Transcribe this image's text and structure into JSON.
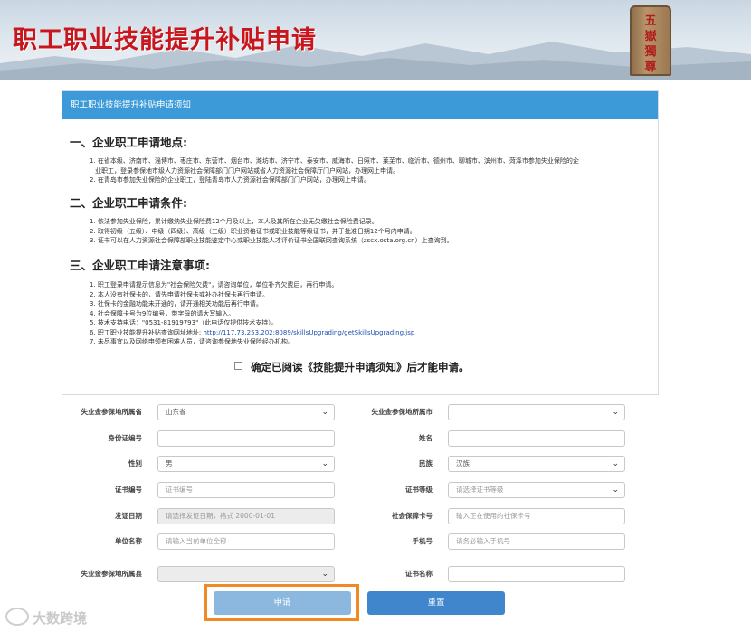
{
  "header": {
    "title": "职工职业技能提升补贴申请",
    "seal_text": [
      "五",
      "嶽",
      "獨",
      "尊"
    ]
  },
  "notice": {
    "heading": "职工职业技能提升补贴申请须知",
    "sections": [
      {
        "title": "一、企业职工申请地点:",
        "items": [
          "1. 在省本级、济南市、淄博市、枣庄市、东营市、烟台市、潍坊市、济宁市、泰安市、威海市、日照市、莱芜市、临沂市、德州市、聊城市、滨州市、菏泽市参加失业保险的企",
          "业职工，登录参保地市级人力资源社会保障部门门户网站或省人力资源社会保障厅门户网站，办理网上申请。",
          "2. 在青岛市参加失业保险的企业职工，登陆青岛市人力资源社会保障部门门户网站，办理网上申请。"
        ]
      },
      {
        "title": "二、企业职工申请条件:",
        "items": [
          "1. 依法参加失业保险，累计缴纳失业保险费12个月及以上，本人及其所在企业无欠缴社会保险费记录。",
          "2. 取得初级（五级）、中级（四级）、高级（三级）职业资格证书或职业技能等级证书，并于批准日期12个月内申请。",
          "3. 证书可以在人力资源社会保障部职业技能鉴定中心或职业技能人才评价证书全国联网查询系统（zscx.osta.org.cn）上查询到。"
        ]
      },
      {
        "title": "三、企业职工申请注意事项:",
        "items": [
          "1. 职工登录申请提示信息为\"社会保险欠费\"，请咨询单位，单位补齐欠费后，再行申请。",
          "2. 本人没有社保卡的，请先申请社保卡或补办社保卡再行申请。",
          "3. 社保卡的金融功能未开通的，请开通相关功能后再行申请。",
          "4. 社会保障卡号为9位编号，带字母的请大写输入。",
          "5. 技术支持电话：\"0531-81919793\"（此电话仅提供技术支持）。",
          "6. 职工职业技能提升补贴查询网址地址:",
          "7. 未尽事宜以及网络申领有困难人员，请咨询参保地失业保险经办机构。"
        ],
        "link": "http://117.73.253.202:8089/skillsUpgrading/getSkillsUpgrading.jsp"
      }
    ],
    "confirm": "确定已阅读《技能提升申请须知》后才能申请。"
  },
  "form": {
    "province_label": "失业金参保地所属省",
    "province_value": "山东省",
    "city_label": "失业金参保地所属市",
    "city_value": "",
    "idno_label": "身份证编号",
    "idno_value": "",
    "name_label": "姓名",
    "name_value": "",
    "gender_label": "性别",
    "gender_value": "男",
    "ethnic_label": "民族",
    "ethnic_value": "汉族",
    "certno_label": "证书编号",
    "certno_placeholder": "证书编号",
    "certlevel_label": "证书等级",
    "certlevel_placeholder": "请选择证书等级",
    "issuedate_label": "发证日期",
    "issuedate_placeholder": "请选择发证日期，格式 2000-01-01",
    "sscard_label": "社会保障卡号",
    "sscard_placeholder": "输入正在使用的社保卡号",
    "company_label": "单位名称",
    "company_placeholder": "请输入当前单位全称",
    "phone_label": "手机号",
    "phone_placeholder": "请务必输入手机号",
    "county_label": "失业金参保地所属县",
    "county_value": "",
    "certname_label": "证书名称",
    "certname_value": ""
  },
  "buttons": {
    "apply": "申请",
    "reset": "重置"
  },
  "watermark": "大数跨境",
  "colors": {
    "header_red": "#c8161d",
    "notice_bar": "#3d9ad9",
    "apply_btn": "#8cb8e0",
    "reset_btn": "#3f86cc",
    "highlight": "#f08a24"
  }
}
